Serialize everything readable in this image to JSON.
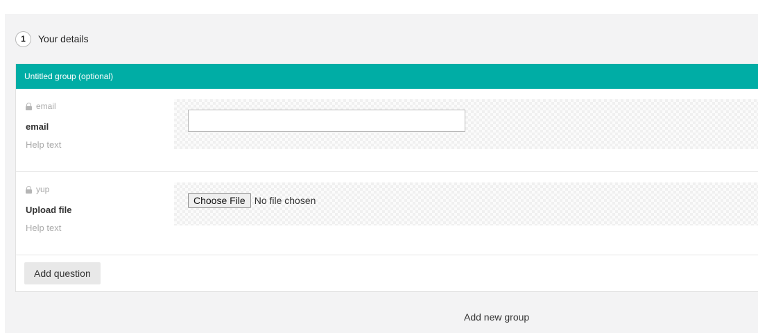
{
  "step": {
    "number": "1",
    "title": "Your details"
  },
  "group": {
    "title": "Untitled group (optional)",
    "questions": [
      {
        "key": "email",
        "label": "email",
        "help": "Help text",
        "type": "text",
        "value": ""
      },
      {
        "key": "yup",
        "label": "Upload file",
        "help": "Help text",
        "type": "file",
        "button_label": "Choose File",
        "status": "No file chosen"
      }
    ],
    "add_question_label": "Add question"
  },
  "add_group_label": "Add new group",
  "icons": {
    "question_key": "lock-icon"
  },
  "colors": {
    "group_header": "#00ada5",
    "panel_background": "#f3f3f4"
  }
}
